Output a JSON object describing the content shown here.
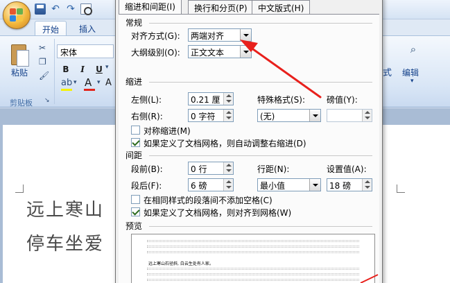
{
  "word": {
    "tabs": {
      "home": "开始",
      "insert": "插入"
    },
    "ribbon": {
      "paste_label": "粘贴",
      "clipboard_group": "剪贴板",
      "font_name": "宋体",
      "bold": "B",
      "italic": "I",
      "underline": "U",
      "style_fragment": "式",
      "editing_label": "编辑"
    },
    "document": {
      "line1": "远上寒山",
      "line2": "停车坐爱"
    }
  },
  "dialog": {
    "tabs": [
      "缩进和间距(I)",
      "换行和分页(P)",
      "中文版式(H)"
    ],
    "general": {
      "title": "常规",
      "alignment_label": "对齐方式(G):",
      "alignment_value": "两端对齐",
      "outline_label": "大纲级别(O):",
      "outline_value": "正文文本"
    },
    "indent": {
      "title": "缩进",
      "left_label": "左侧(L):",
      "left_value": "0.21 厘",
      "right_label": "右侧(R):",
      "right_value": "0 字符",
      "special_label": "特殊格式(S):",
      "special_value": "(无)",
      "by_label": "磅值(Y):",
      "by_value": "",
      "mirror_label": "对称缩进(M)",
      "mirror_checked": false,
      "auto_adjust_label": "如果定义了文档网格，则自动调整右缩进(D)",
      "auto_adjust_checked": true
    },
    "spacing": {
      "title": "间距",
      "before_label": "段前(B):",
      "before_value": "0 行",
      "after_label": "段后(F):",
      "after_value": "6 磅",
      "line_label": "行距(N):",
      "line_value": "最小值",
      "at_label": "设置值(A):",
      "at_value": "18 磅",
      "no_space_label": "在相同样式的段落间不添加空格(C)",
      "no_space_checked": false,
      "snap_grid_label": "如果定义了文档网格，则对齐到网格(W)",
      "snap_grid_checked": true
    },
    "preview": {
      "title": "预览",
      "sample_text": "远上寒山石径斜, 白云生处有人家。"
    }
  },
  "colors": {
    "arrow": "#e8201c",
    "ribbon_text": "#15428b"
  }
}
